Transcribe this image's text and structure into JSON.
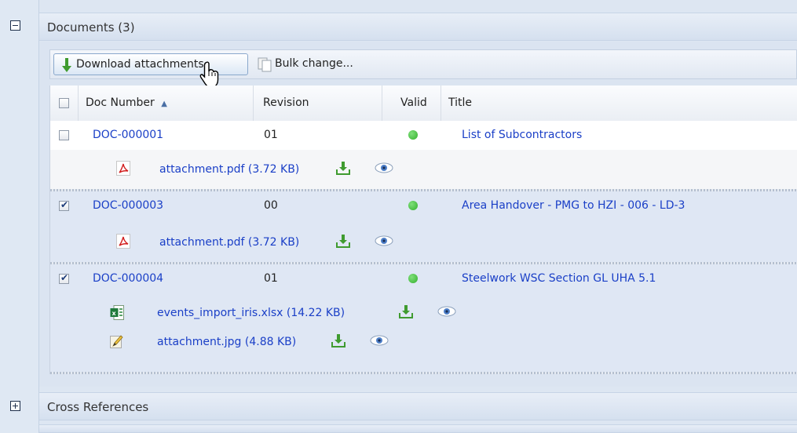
{
  "documents_panel": {
    "title": "Documents (3)"
  },
  "toolbar": {
    "download_label": "Download attachments",
    "bulk_label": "Bulk change..."
  },
  "grid": {
    "columns": {
      "doc_number": "Doc Number",
      "revision": "Revision",
      "valid": "Valid",
      "title": "Title"
    },
    "sort_indicator": "▲",
    "rows": [
      {
        "doc_number": "DOC-000001",
        "revision": "01",
        "title": "List of Subcontractors",
        "checked": false,
        "attachments": [
          {
            "name": "attachment.pdf (3.72 KB)",
            "icon": "pdf-icon"
          }
        ]
      },
      {
        "doc_number": "DOC-000003",
        "revision": "00",
        "title": "Area Handover - PMG to HZI - 006 - LD-3",
        "checked": true,
        "attachments": [
          {
            "name": "attachment.pdf (3.72 KB)",
            "icon": "pdf-icon"
          }
        ]
      },
      {
        "doc_number": "DOC-000004",
        "revision": "01",
        "title": "Steelwork WSC Section GL UHA 5.1",
        "checked": true,
        "attachments": [
          {
            "name": "events_import_iris.xlsx (14.22 KB)",
            "icon": "excel-icon"
          },
          {
            "name": "attachment.jpg (4.88 KB)",
            "icon": "image-edit-icon"
          }
        ]
      }
    ]
  },
  "cross_references_panel": {
    "title": "Cross References"
  },
  "colors": {
    "link": "#1a3fc7",
    "valid_dot": "#34b02d",
    "selected_row": "#dfe7f4",
    "panel_bg": "#dbe4f1"
  }
}
